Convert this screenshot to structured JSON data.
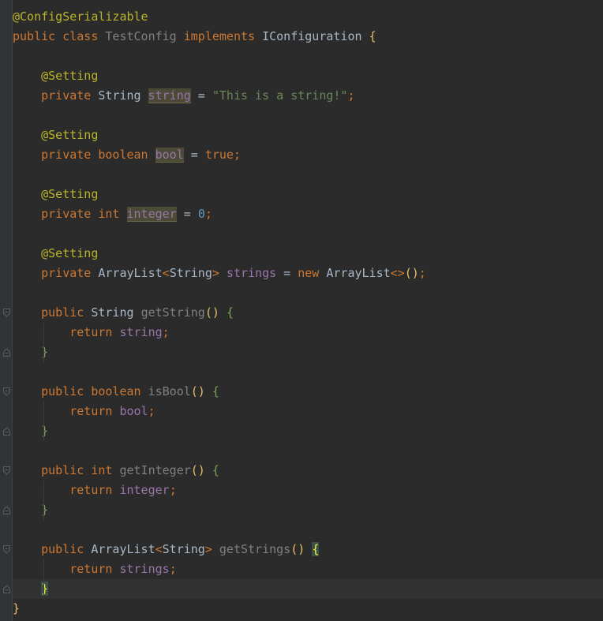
{
  "lines": [
    [
      {
        "t": "@ConfigSerializable",
        "c": "ann"
      }
    ],
    [
      {
        "t": "public ",
        "c": "kw"
      },
      {
        "t": "class ",
        "c": "kw"
      },
      {
        "t": "TestConfig",
        "c": "unused"
      },
      {
        "t": " "
      },
      {
        "t": "implements ",
        "c": "kw"
      },
      {
        "t": "IConfiguration"
      },
      {
        "t": " "
      },
      {
        "t": "{",
        "c": "brk-y"
      }
    ],
    [],
    [
      {
        "t": "    "
      },
      {
        "t": "@Setting",
        "c": "ann"
      }
    ],
    [
      {
        "t": "    "
      },
      {
        "t": "private ",
        "c": "kw"
      },
      {
        "t": "String "
      },
      {
        "t": "string",
        "c": "fld hl"
      },
      {
        "t": " = "
      },
      {
        "t": "\"This is a string!\"",
        "c": "str"
      },
      {
        "t": ";",
        "c": "kw"
      }
    ],
    [],
    [
      {
        "t": "    "
      },
      {
        "t": "@Setting",
        "c": "ann"
      }
    ],
    [
      {
        "t": "    "
      },
      {
        "t": "private ",
        "c": "kw"
      },
      {
        "t": "boolean ",
        "c": "kw"
      },
      {
        "t": "bool",
        "c": "fld hl"
      },
      {
        "t": " = "
      },
      {
        "t": "true",
        "c": "kw"
      },
      {
        "t": ";",
        "c": "kw"
      }
    ],
    [],
    [
      {
        "t": "    "
      },
      {
        "t": "@Setting",
        "c": "ann"
      }
    ],
    [
      {
        "t": "    "
      },
      {
        "t": "private ",
        "c": "kw"
      },
      {
        "t": "int ",
        "c": "kw"
      },
      {
        "t": "integer",
        "c": "fld hl"
      },
      {
        "t": " = "
      },
      {
        "t": "0",
        "c": "num"
      },
      {
        "t": ";",
        "c": "kw"
      }
    ],
    [],
    [
      {
        "t": "    "
      },
      {
        "t": "@Setting",
        "c": "ann"
      }
    ],
    [
      {
        "t": "    "
      },
      {
        "t": "private ",
        "c": "kw"
      },
      {
        "t": "ArrayList"
      },
      {
        "t": "<",
        "c": "kw"
      },
      {
        "t": "String"
      },
      {
        "t": ">",
        "c": "kw"
      },
      {
        "t": " "
      },
      {
        "t": "strings",
        "c": "fld"
      },
      {
        "t": " = "
      },
      {
        "t": "new ",
        "c": "kw"
      },
      {
        "t": "ArrayList"
      },
      {
        "t": "<>",
        "c": "kw"
      },
      {
        "t": "()",
        "c": "brk-y"
      },
      {
        "t": ";",
        "c": "kw"
      }
    ],
    [],
    [
      {
        "t": "    "
      },
      {
        "t": "public ",
        "c": "kw"
      },
      {
        "t": "String "
      },
      {
        "t": "getString",
        "c": "unused"
      },
      {
        "t": "()",
        "c": "brk-y"
      },
      {
        "t": " "
      },
      {
        "t": "{",
        "c": "brk-g"
      }
    ],
    [
      {
        "t": "        "
      },
      {
        "t": "return ",
        "c": "kw"
      },
      {
        "t": "string",
        "c": "fld"
      },
      {
        "t": ";",
        "c": "kw"
      }
    ],
    [
      {
        "t": "    "
      },
      {
        "t": "}",
        "c": "brk-g"
      }
    ],
    [],
    [
      {
        "t": "    "
      },
      {
        "t": "public ",
        "c": "kw"
      },
      {
        "t": "boolean ",
        "c": "kw"
      },
      {
        "t": "isBool",
        "c": "unused"
      },
      {
        "t": "()",
        "c": "brk-y"
      },
      {
        "t": " "
      },
      {
        "t": "{",
        "c": "brk-g"
      }
    ],
    [
      {
        "t": "        "
      },
      {
        "t": "return ",
        "c": "kw"
      },
      {
        "t": "bool",
        "c": "fld"
      },
      {
        "t": ";",
        "c": "kw"
      }
    ],
    [
      {
        "t": "    "
      },
      {
        "t": "}",
        "c": "brk-g"
      }
    ],
    [],
    [
      {
        "t": "    "
      },
      {
        "t": "public ",
        "c": "kw"
      },
      {
        "t": "int ",
        "c": "kw"
      },
      {
        "t": "getInteger",
        "c": "unused"
      },
      {
        "t": "()",
        "c": "brk-y"
      },
      {
        "t": " "
      },
      {
        "t": "{",
        "c": "brk-g"
      }
    ],
    [
      {
        "t": "        "
      },
      {
        "t": "return ",
        "c": "kw"
      },
      {
        "t": "integer",
        "c": "fld"
      },
      {
        "t": ";",
        "c": "kw"
      }
    ],
    [
      {
        "t": "    "
      },
      {
        "t": "}",
        "c": "brk-g"
      }
    ],
    [],
    [
      {
        "t": "    "
      },
      {
        "t": "public ",
        "c": "kw"
      },
      {
        "t": "ArrayList"
      },
      {
        "t": "<",
        "c": "kw"
      },
      {
        "t": "String"
      },
      {
        "t": ">",
        "c": "kw"
      },
      {
        "t": " "
      },
      {
        "t": "getStrings",
        "c": "unused"
      },
      {
        "t": "()",
        "c": "brk-y"
      },
      {
        "t": " "
      },
      {
        "t": "{",
        "c": "brace-match"
      }
    ],
    [
      {
        "t": "        "
      },
      {
        "t": "return ",
        "c": "kw"
      },
      {
        "t": "strings",
        "c": "fld"
      },
      {
        "t": ";",
        "c": "kw"
      }
    ],
    [
      {
        "t": "    "
      },
      {
        "t": "}",
        "c": "brace-match"
      }
    ],
    [
      {
        "t": "}",
        "c": "brk-y"
      }
    ]
  ],
  "current_line": 29,
  "fold_markers": [
    {
      "line": 15,
      "kind": "open"
    },
    {
      "line": 17,
      "kind": "close"
    },
    {
      "line": 19,
      "kind": "open"
    },
    {
      "line": 21,
      "kind": "close"
    },
    {
      "line": 23,
      "kind": "open"
    },
    {
      "line": 25,
      "kind": "close"
    },
    {
      "line": 27,
      "kind": "open"
    },
    {
      "line": 29,
      "kind": "close"
    }
  ],
  "indent_guides": [
    {
      "from": 16,
      "to": 17,
      "depth": 1
    },
    {
      "from": 20,
      "to": 21,
      "depth": 1
    },
    {
      "from": 24,
      "to": 25,
      "depth": 1
    },
    {
      "from": 28,
      "to": 29,
      "depth": 1
    }
  ],
  "colors": {
    "background": "#2b2b2b",
    "gutter": "#313335",
    "keyword": "#cc7832",
    "annotation": "#bbb529",
    "string": "#6a8759",
    "number": "#6897bb",
    "field": "#9876aa",
    "unused": "#808080",
    "default_text": "#a9b7c6"
  }
}
